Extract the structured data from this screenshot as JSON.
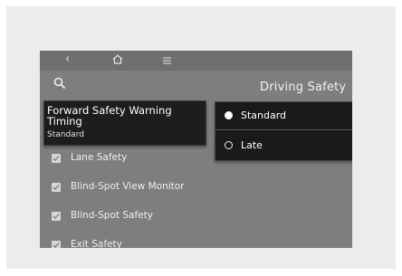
{
  "nav": {
    "back_icon": "chevron-left-icon",
    "home_icon": "home-icon",
    "menu_icon": "menu-icon"
  },
  "search_icon": "search-icon",
  "section": {
    "title": "Driving Safety"
  },
  "selected_item": {
    "title": "Forward Safety Warning Timing",
    "value": "Standard"
  },
  "list": [
    {
      "label": "Lane Safety",
      "checked": true
    },
    {
      "label": "Blind-Spot View Monitor",
      "checked": true
    },
    {
      "label": "Blind-Spot Safety",
      "checked": true
    },
    {
      "label": "Exit Safety",
      "checked": true
    }
  ],
  "options": [
    {
      "label": "Standard",
      "selected": true
    },
    {
      "label": "Late",
      "selected": false
    }
  ]
}
